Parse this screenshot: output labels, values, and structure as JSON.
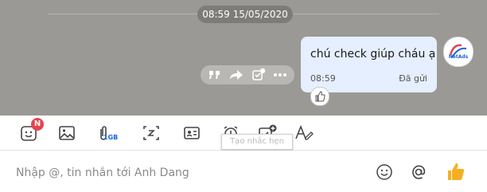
{
  "chat": {
    "date_separator": "08:59 15/05/2020",
    "message": {
      "text": "chú check giúp cháu ạ",
      "time": "08:59",
      "status": "Đã gửi"
    },
    "avatar_logo_text": "NetAds"
  },
  "toolbar": {
    "sticker_badge": "N",
    "attach_size_label": "1GB",
    "reminder_tooltip": "Tạo nhắc hẹn"
  },
  "composer": {
    "placeholder": "Nhập @, tin nhắn tới Anh Dang"
  },
  "colors": {
    "chat_bg": "#9b9995",
    "bubble_bg": "#e5efff",
    "badge": "#e6434f",
    "accent": "#1763d8",
    "like_yellow": "#f5b021"
  }
}
